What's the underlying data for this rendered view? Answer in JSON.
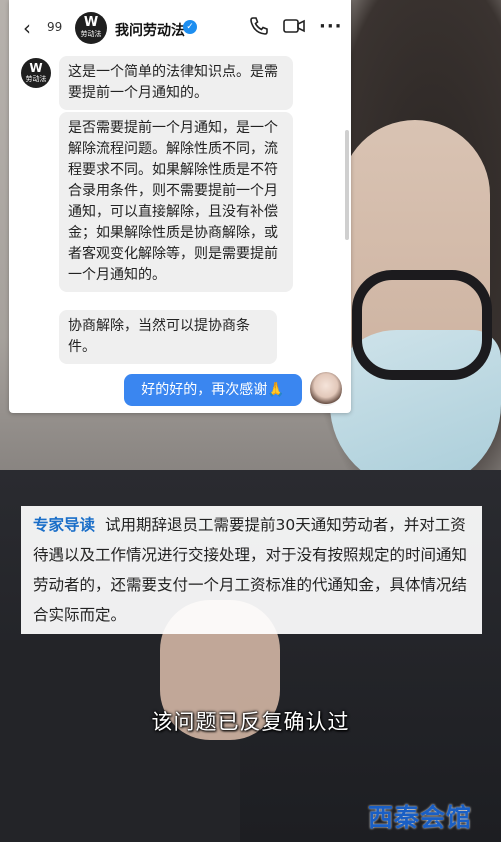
{
  "header": {
    "unread_count": "99",
    "app_logo_text": "劳动法",
    "title": "我问劳动法"
  },
  "messages": {
    "bot_avatar_text": "劳动法",
    "bubble_1": "这是一个简单的法律知识点。是需要提前一个月通知的。",
    "bubble_2": "是否需要提前一个月通知，是一个解除流程问题。解除性质不同，流程要求不同。如果解除性质是不符合录用条件，则不需要提前一个月通知，可以直接解除，且没有补偿金；如果解除性质是协商解除，或者客观变化解除等，则是需要提前一个月通知的。",
    "bubble_3": "协商解除，当然可以提协商条件。",
    "outgoing": "好的好的，再次感谢🙏"
  },
  "guide": {
    "label": "专家导读",
    "text": "试用期辞退员工需要提前30天通知劳动者，并对工资待遇以及工作情况进行交接处理，对于没有按照规定的时间通知劳动者的，还需要支付一个月工资标准的代通知金，具体情况结合实际而定。"
  },
  "subtitle": "该问题已反复确认过",
  "watermark": "西秦会馆",
  "colors": {
    "accent_blue": "#3a86f0",
    "guide_label": "#1a6ec8",
    "watermark": "#1a5fc4"
  },
  "icons": [
    "back-icon",
    "verified-icon",
    "phone-icon",
    "video-icon",
    "more-icon"
  ]
}
